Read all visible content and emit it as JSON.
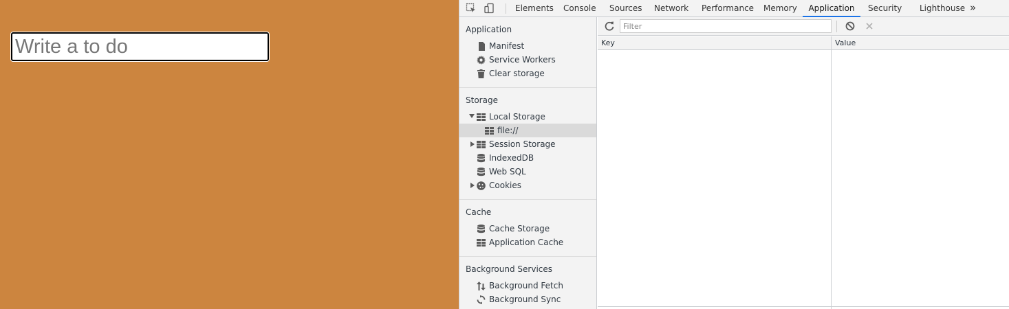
{
  "page": {
    "todo_placeholder": "Write a to do",
    "background_color": "#cc853f"
  },
  "devtools": {
    "tabs": [
      {
        "label": "Elements"
      },
      {
        "label": "Console"
      },
      {
        "label": "Sources"
      },
      {
        "label": "Network"
      },
      {
        "label": "Performance"
      },
      {
        "label": "Memory"
      },
      {
        "label": "Application",
        "active": true
      },
      {
        "label": "Security"
      },
      {
        "label": "Lighthouse"
      }
    ],
    "more_tabs": "»",
    "sidebar": {
      "application": {
        "title": "Application",
        "items": [
          {
            "label": "Manifest",
            "icon": "document-icon"
          },
          {
            "label": "Service Workers",
            "icon": "gear-icon"
          },
          {
            "label": "Clear storage",
            "icon": "trash-icon"
          }
        ]
      },
      "storage": {
        "title": "Storage",
        "items": [
          {
            "label": "Local Storage",
            "icon": "grid-icon",
            "expanded": true
          },
          {
            "label": "file://",
            "icon": "grid-icon",
            "selected": true
          },
          {
            "label": "Session Storage",
            "icon": "grid-icon",
            "expanded": false
          },
          {
            "label": "IndexedDB",
            "icon": "database-icon"
          },
          {
            "label": "Web SQL",
            "icon": "database-icon"
          },
          {
            "label": "Cookies",
            "icon": "cookie-icon",
            "expanded": false
          }
        ]
      },
      "cache": {
        "title": "Cache",
        "items": [
          {
            "label": "Cache Storage",
            "icon": "database-icon"
          },
          {
            "label": "Application Cache",
            "icon": "grid-icon"
          }
        ]
      },
      "background": {
        "title": "Background Services",
        "items": [
          {
            "label": "Background Fetch",
            "icon": "up-down-arrows-icon"
          },
          {
            "label": "Background Sync",
            "icon": "sync-icon"
          }
        ]
      }
    },
    "toolbar": {
      "filter_placeholder": "Filter"
    },
    "table": {
      "columns": [
        "Key",
        "Value"
      ],
      "rows": []
    },
    "accent_color": "#1a73e8"
  }
}
